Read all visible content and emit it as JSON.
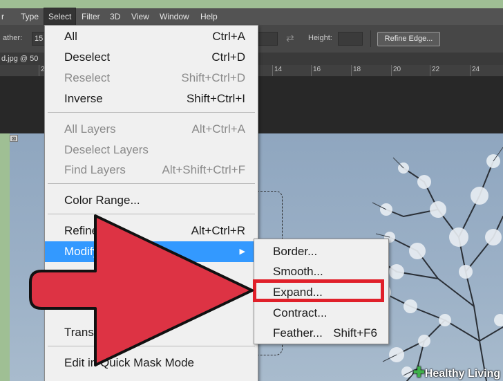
{
  "menubar": {
    "items": [
      {
        "label": "r"
      },
      {
        "label": "Type"
      },
      {
        "label": "Select",
        "active": true
      },
      {
        "label": "Filter"
      },
      {
        "label": "3D"
      },
      {
        "label": "View"
      },
      {
        "label": "Window"
      },
      {
        "label": "Help"
      }
    ]
  },
  "options": {
    "feather_label": "ather:",
    "feather_value": "15",
    "height_label": "Height:",
    "refine_edge": "Refine Edge..."
  },
  "tab": {
    "title": "d.jpg @ 50"
  },
  "ruler": {
    "ticks": [
      "2",
      "14",
      "16",
      "18",
      "20",
      "22",
      "24"
    ]
  },
  "select_menu": {
    "items": [
      {
        "label": "All",
        "shortcut": "Ctrl+A"
      },
      {
        "label": "Deselect",
        "shortcut": "Ctrl+D"
      },
      {
        "label": "Reselect",
        "shortcut": "Shift+Ctrl+D",
        "disabled": true
      },
      {
        "label": "Inverse",
        "shortcut": "Shift+Ctrl+I"
      },
      {
        "label": "All Layers",
        "shortcut": "Alt+Ctrl+A",
        "disabled": true
      },
      {
        "label": "Deselect Layers",
        "shortcut": "",
        "disabled": true
      },
      {
        "label": "Find Layers",
        "shortcut": "Alt+Shift+Ctrl+F",
        "disabled": true
      },
      {
        "label": "Color Range...",
        "shortcut": ""
      },
      {
        "label": "Refine",
        "shortcut": "Alt+Ctrl+R"
      },
      {
        "label": "Modify",
        "shortcut": "",
        "highlighted": true,
        "submenu_arrow": "▶"
      },
      {
        "label": "Transfo",
        "shortcut": ""
      },
      {
        "label": "Edit in Quick Mask Mode",
        "shortcut": ""
      }
    ]
  },
  "modify_submenu": {
    "items": [
      {
        "label": "Border...",
        "shortcut": ""
      },
      {
        "label": "Smooth...",
        "shortcut": ""
      },
      {
        "label": "Expand...",
        "shortcut": "",
        "callout": true
      },
      {
        "label": "Contract...",
        "shortcut": ""
      },
      {
        "label": "Feather...",
        "shortcut": "Shift+F6"
      }
    ]
  },
  "colors": {
    "menu_highlight": "#3399ff",
    "callout_red": "#e0202a",
    "arrow_red": "#dd3344",
    "frame_green": "#9fbf94"
  },
  "watermark": {
    "text": "Healthy Living",
    "icon": "plus-icon"
  }
}
